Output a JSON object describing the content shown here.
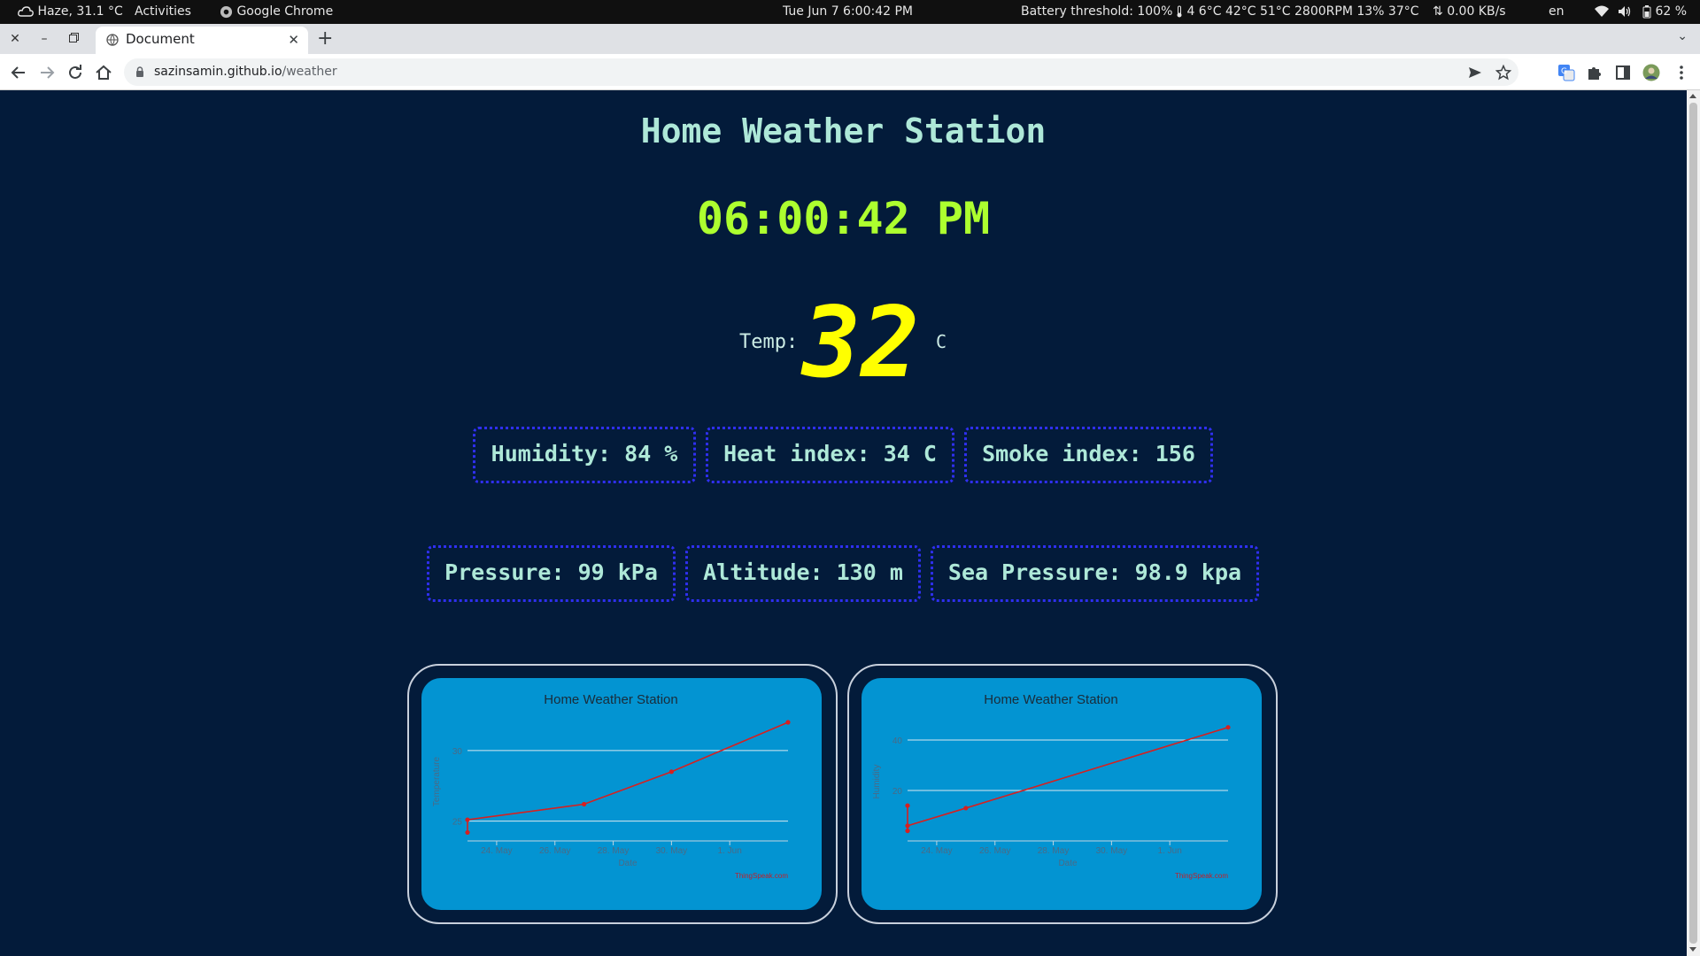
{
  "system_bar": {
    "weather": "Haze, 31.1 °C",
    "activities": "Activities",
    "app": "Google Chrome",
    "datetime": "Tue Jun 7  6:00:42 PM",
    "battery_threshold": "Battery threshold: 100%",
    "sensors": "4 6°C 42°C 51°C 2800RPM 13% 37°C",
    "network": "0.00 KB/s",
    "lang": "en",
    "battery": "62 %"
  },
  "browser": {
    "tab_title": "Document",
    "url_host": "sazinsamin.github.io",
    "url_path": "/weather"
  },
  "page": {
    "title": "Home Weather Station",
    "clock": "06:00:42 PM",
    "temp_label": "Temp:",
    "temp_value": "32",
    "temp_unit": "C",
    "stats_row1": [
      {
        "text": "Humidity: 84 %"
      },
      {
        "text": "Heat index: 34 C"
      },
      {
        "text": "Smoke index: 156"
      }
    ],
    "stats_row2": [
      {
        "text": "Pressure: 99 kPa"
      },
      {
        "text": "Altitude: 130 m"
      },
      {
        "text": "Sea Pressure: 98.9 kpa"
      }
    ]
  },
  "colors": {
    "page_bg": "#031b3a",
    "title_text": "#aee8d8",
    "clock": "#adff2f",
    "temp_value": "#ffff00",
    "box_border": "#2f2ff0",
    "chart_panel": "#0394d2",
    "series_line": "#d62020"
  },
  "chart_data": [
    {
      "type": "line",
      "title": "Home Weather Station",
      "xlabel": "Date",
      "ylabel": "Temperature",
      "x_ticks": [
        "24. May",
        "26. May",
        "28. May",
        "30. May",
        "1. Jun"
      ],
      "y_ticks": [
        25,
        30
      ],
      "ylim": [
        23.6,
        32
      ],
      "x": [
        "23. May",
        "23. May",
        "27. May",
        "30. May",
        "3. Jun"
      ],
      "series": [
        {
          "values": [
            24.2,
            25.1,
            26.2,
            28.5,
            32.0
          ]
        }
      ],
      "credit": "ThingSpeak.com",
      "grid": true
    },
    {
      "type": "line",
      "title": "Home Weather Station",
      "xlabel": "Date",
      "ylabel": "Humidity",
      "x_ticks": [
        "24. May",
        "26. May",
        "28. May",
        "30. May",
        "1. Jun"
      ],
      "y_ticks": [
        20,
        40
      ],
      "ylim": [
        0,
        47
      ],
      "x": [
        "23. May",
        "23. May",
        "23. May",
        "25. May",
        "3. Jun"
      ],
      "series": [
        {
          "values": [
            14.0,
            4.0,
            6.0,
            13.0,
            45.0
          ]
        }
      ],
      "credit": "ThingSpeak.com",
      "grid": true
    }
  ]
}
